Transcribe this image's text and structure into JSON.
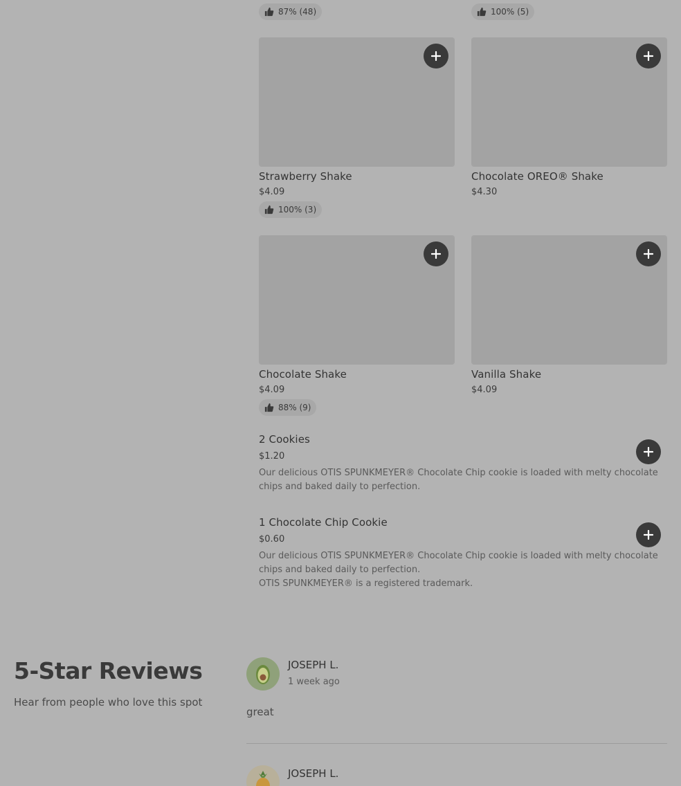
{
  "top_ratings": [
    {
      "text": "87% (48)"
    },
    {
      "text": "100% (5)"
    }
  ],
  "grid_items": [
    {
      "name": "Strawberry Shake",
      "price": "$4.09",
      "rating": "100% (3)"
    },
    {
      "name": "Chocolate OREO® Shake",
      "price": "$4.30",
      "rating": null
    },
    {
      "name": "Chocolate Shake",
      "price": "$4.09",
      "rating": "88% (9)"
    },
    {
      "name": "Vanilla Shake",
      "price": "$4.09",
      "rating": null
    }
  ],
  "list_items": [
    {
      "name": "2 Cookies",
      "price": "$1.20",
      "desc": [
        "Our delicious OTIS SPUNKMEYER® Chocolate Chip cookie is loaded with melty chocolate",
        "chips and baked daily to perfection."
      ]
    },
    {
      "name": "1 Chocolate Chip Cookie",
      "price": "$0.60",
      "desc": [
        "Our delicious OTIS SPUNKMEYER® Chocolate Chip cookie is loaded with melty chocolate",
        "chips and baked daily to perfection.",
        "OTIS SPUNKMEYER® is a registered trademark."
      ]
    }
  ],
  "reviews_section": {
    "title": "5-Star Reviews",
    "subtitle": "Hear from people who love this spot"
  },
  "reviews": [
    {
      "name": "JOSEPH L.",
      "time": "1 week ago",
      "text": "great",
      "avatar_icon": "avocado-icon"
    },
    {
      "name": "JOSEPH L.",
      "avatar_icon": "pineapple-icon"
    }
  ],
  "icons": {
    "rating": "thumbs-up-icon",
    "add": "plus-icon"
  },
  "colors": {
    "background": "#b3b3b3",
    "button": "#3a3a3a",
    "pill": "#a8a8a8"
  }
}
